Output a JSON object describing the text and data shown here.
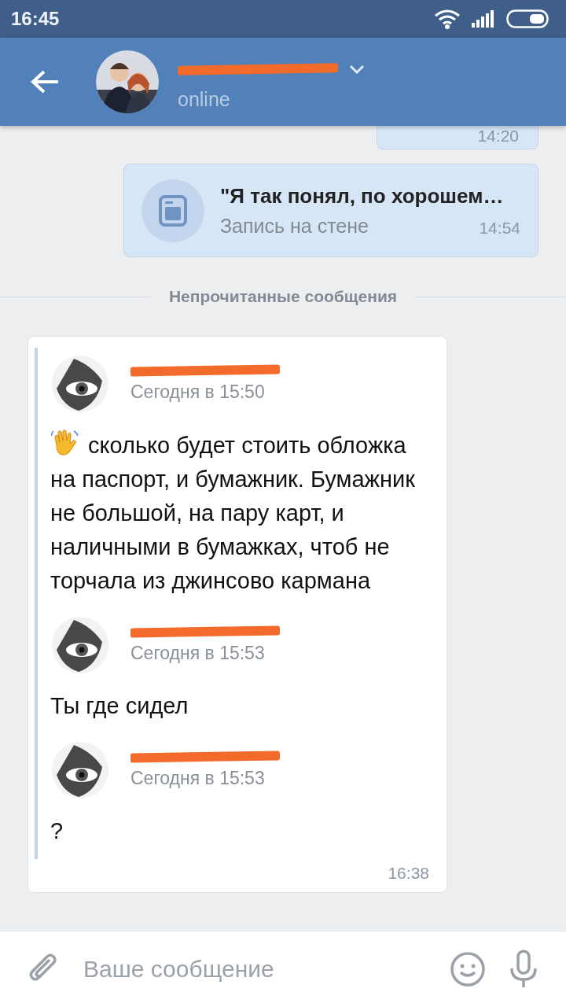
{
  "status_bar": {
    "time": "16:45"
  },
  "header": {
    "name_redacted": true,
    "status": "online"
  },
  "messages": [
    {
      "kind": "cut",
      "time": "14:20"
    },
    {
      "kind": "wall_post",
      "title": "\"Я так понял, по хорошем…",
      "subtitle": "Запись на стене",
      "time": "14:54"
    }
  ],
  "unread_divider": "Непрочитанные сообщения",
  "forwarded": {
    "time": "16:38",
    "items": [
      {
        "name_redacted": true,
        "date": "Сегодня в 15:50",
        "emoji": true,
        "text": "сколько будет стоить обложка на паспорт, и бумажник. Бумажник не большой, на пару карт, и наличными в бумажках, чтоб не торчала из джинсово кармана"
      },
      {
        "name_redacted": true,
        "date": "Сегодня в 15:53",
        "emoji": false,
        "text": "Ты где сидел"
      },
      {
        "name_redacted": true,
        "date": "Сегодня в 15:53",
        "emoji": false,
        "text": "?"
      }
    ]
  },
  "composer": {
    "placeholder": "Ваше сообщение"
  }
}
